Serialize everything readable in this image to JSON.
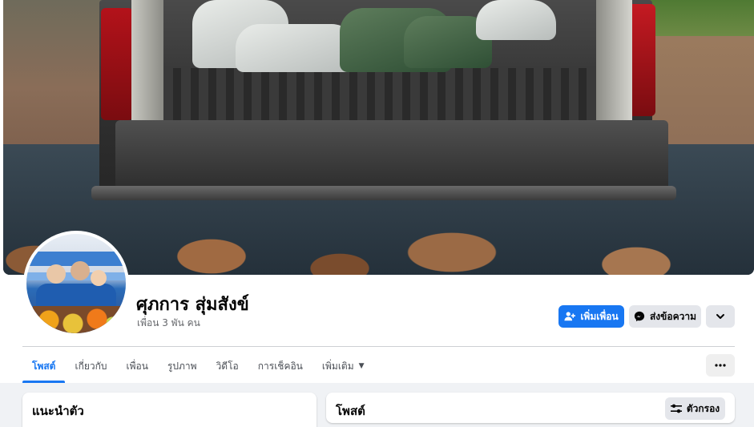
{
  "profile": {
    "name": "ศุภการ สุ่มสังข์",
    "friend_count": "เพื่อน 3 พัน คน"
  },
  "actions": {
    "add_friend": "เพิ่มเพื่อน",
    "message": "ส่งข้อความ"
  },
  "tabs": [
    {
      "label": "โพสต์",
      "active": true
    },
    {
      "label": "เกี่ยวกับ",
      "active": false
    },
    {
      "label": "เพื่อน",
      "active": false
    },
    {
      "label": "รูปภาพ",
      "active": false
    },
    {
      "label": "วิดีโอ",
      "active": false
    },
    {
      "label": "การเช็คอิน",
      "active": false
    },
    {
      "label": "เพิ่มเติม",
      "active": false,
      "dropdown": true
    }
  ],
  "intro_card": {
    "title": "แนะนำตัว"
  },
  "posts_card": {
    "title": "โพสต์",
    "filter_label": "ตัวกรอง"
  },
  "icons": {
    "add_friend": "person-add-icon",
    "message": "messenger-icon",
    "more": "chevron-down-icon",
    "tab_more": "ellipsis-icon",
    "filter": "sliders-icon"
  },
  "colors": {
    "accent": "#1877f2",
    "background": "#f0f2f5",
    "button_gray": "#e4e6eb"
  }
}
